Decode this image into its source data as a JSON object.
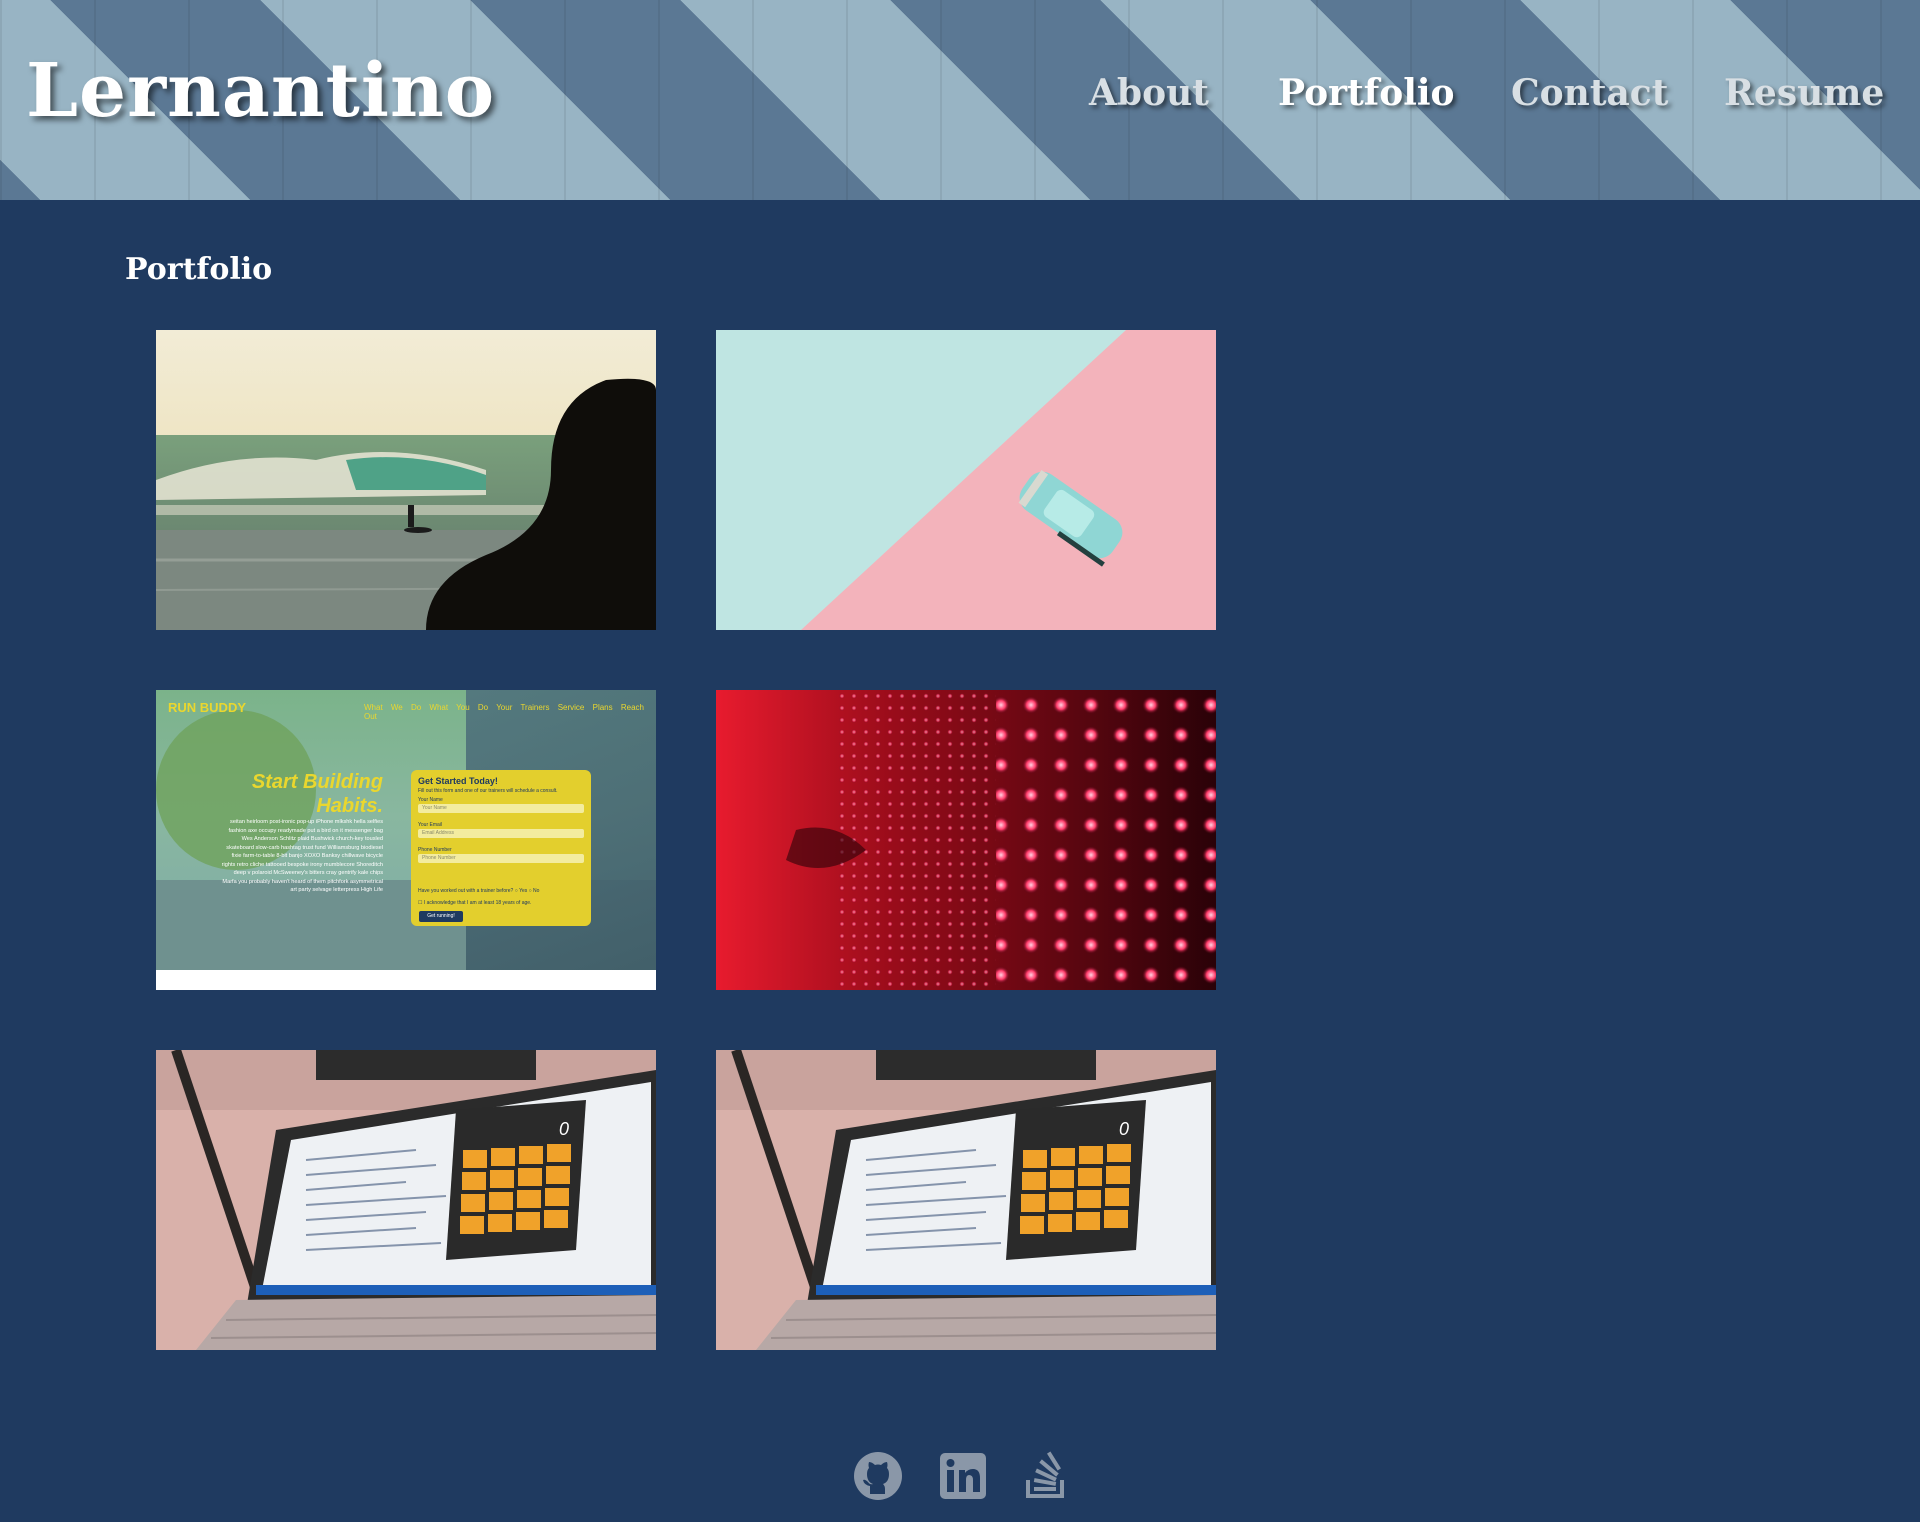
{
  "header": {
    "logo": "Lernantino",
    "nav": [
      {
        "label": "About",
        "active": false
      },
      {
        "label": "Portfolio",
        "active": true
      },
      {
        "label": "Contact",
        "active": false
      },
      {
        "label": "Resume",
        "active": false
      }
    ]
  },
  "main": {
    "section_title": "Portfolio",
    "projects": [
      {
        "image": "surfer-at-sunset"
      },
      {
        "image": "toy-car-on-pastel"
      },
      {
        "image": "run-buddy-screenshot",
        "run_buddy": {
          "brand": "RUN BUDDY",
          "nav_links": "What We Do What You Do Your Trainers Service Plans Reach Out",
          "headline_1": "Start Building",
          "headline_2": "Habits.",
          "paragraph": "seitan heirloom post-ironic pop-up iPhone mlkshk hella selfies fashion axe occupy readymade put a bird on it messenger bag Wes Anderson Schlitz plaid Bushwick church-key tousled skateboard slow-carb hashtag trust fund Williamsburg biodiesel fixie farm-to-table 8-bit banjo XOXO Banksy chillwave bicycle rights retro cliche tattooed bespoke irony mumblecore Shoreditch deep v polaroid McSweeney's bitters cray gentrify kale chips Marfa you probably haven't heard of them pitchfork asymmetrical art party selvage letterpress High Life",
          "form_title": "Get Started Today!",
          "form_sub": "Fill out this form and one of our trainers will schedule a consult.",
          "name_label": "Your Name",
          "name_placeholder": "Your Name",
          "email_label": "Your Email",
          "email_placeholder": "Email Address",
          "phone_label": "Phone Number",
          "phone_placeholder": "Phone Number",
          "question": "Have you worked out with a trainer before?",
          "yes": "Yes",
          "no": "No",
          "ack": "I acknowledge that I am at least 18 years of age.",
          "button": "Get running!"
        }
      },
      {
        "image": "red-led-wall"
      },
      {
        "image": "laptop-calculator-app",
        "calculator_display": "0"
      },
      {
        "image": "laptop-calculator-app",
        "calculator_display": "0"
      }
    ]
  },
  "footer": {
    "icons": [
      "github-icon",
      "linkedin-icon",
      "stack-overflow-icon"
    ]
  },
  "colors": {
    "page_bg": "#1f3a60",
    "header_dark": "#5b7894",
    "header_light": "#98b4c4",
    "footer_icon": "#8a97a8",
    "run_buddy_yellow": "#ead72e"
  }
}
